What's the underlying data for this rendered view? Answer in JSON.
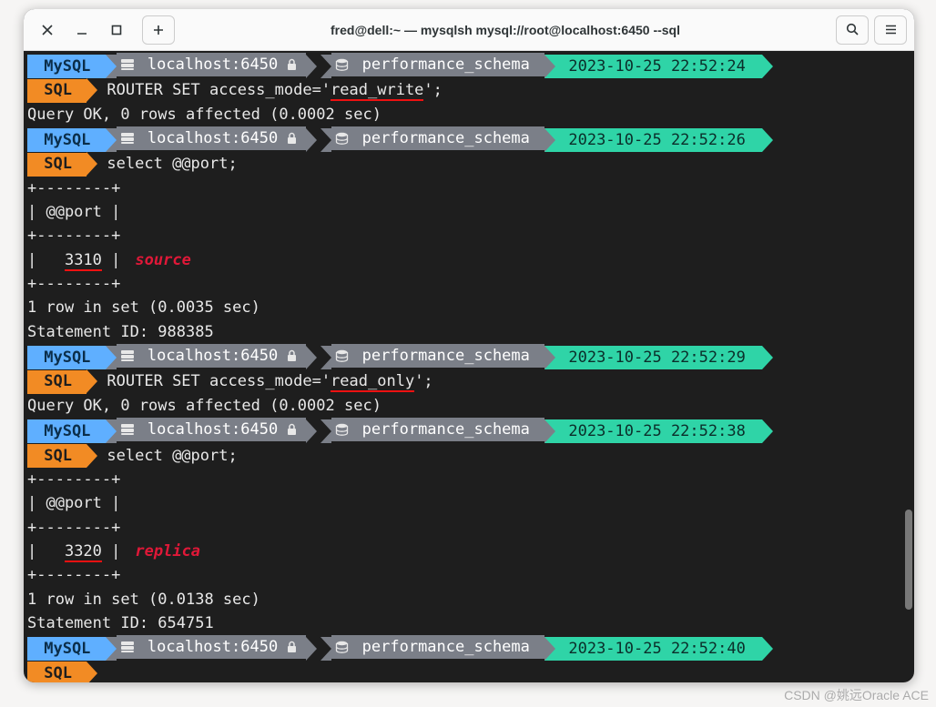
{
  "titlebar": {
    "title": "fred@dell:~ — mysqlsh mysql://root@localhost:6450 --sql"
  },
  "prompt": {
    "mysql": "MySQL",
    "host": "localhost:6450",
    "schema": "performance_schema",
    "sql": "SQL"
  },
  "blocks": [
    {
      "time": "2023-10-25 22:52:24",
      "cmd_pre": "ROUTER SET access_mode='",
      "cmd_ul": "read_write",
      "cmd_post": "';",
      "result": [
        "Query OK, 0 rows affected (0.0002 sec)"
      ]
    },
    {
      "time": "2023-10-25 22:52:26",
      "cmd": "select @@port;",
      "table_head": [
        "+--------+",
        "| @@port |",
        "+--------+"
      ],
      "value_pre": "|   ",
      "value_ul": "3310",
      "value_post": " |",
      "annotation": "source",
      "table_foot": [
        "+--------+"
      ],
      "result": [
        "1 row in set (0.0035 sec)",
        "Statement ID: 988385"
      ]
    },
    {
      "time": "2023-10-25 22:52:29",
      "cmd_pre": "ROUTER SET access_mode='",
      "cmd_ul": "read_only",
      "cmd_post": "';",
      "result": [
        "Query OK, 0 rows affected (0.0002 sec)"
      ]
    },
    {
      "time": "2023-10-25 22:52:38",
      "cmd": "select @@port;",
      "table_head": [
        "+--------+",
        "| @@port |",
        "+--------+"
      ],
      "value_pre": "|   ",
      "value_ul": "3320",
      "value_post": " |",
      "annotation": "replica",
      "table_foot": [
        "+--------+"
      ],
      "result": [
        "1 row in set (0.0138 sec)",
        "Statement ID: 654751"
      ]
    },
    {
      "time": "2023-10-25 22:52:40"
    }
  ],
  "watermark": "CSDN @姚远Oracle ACE"
}
